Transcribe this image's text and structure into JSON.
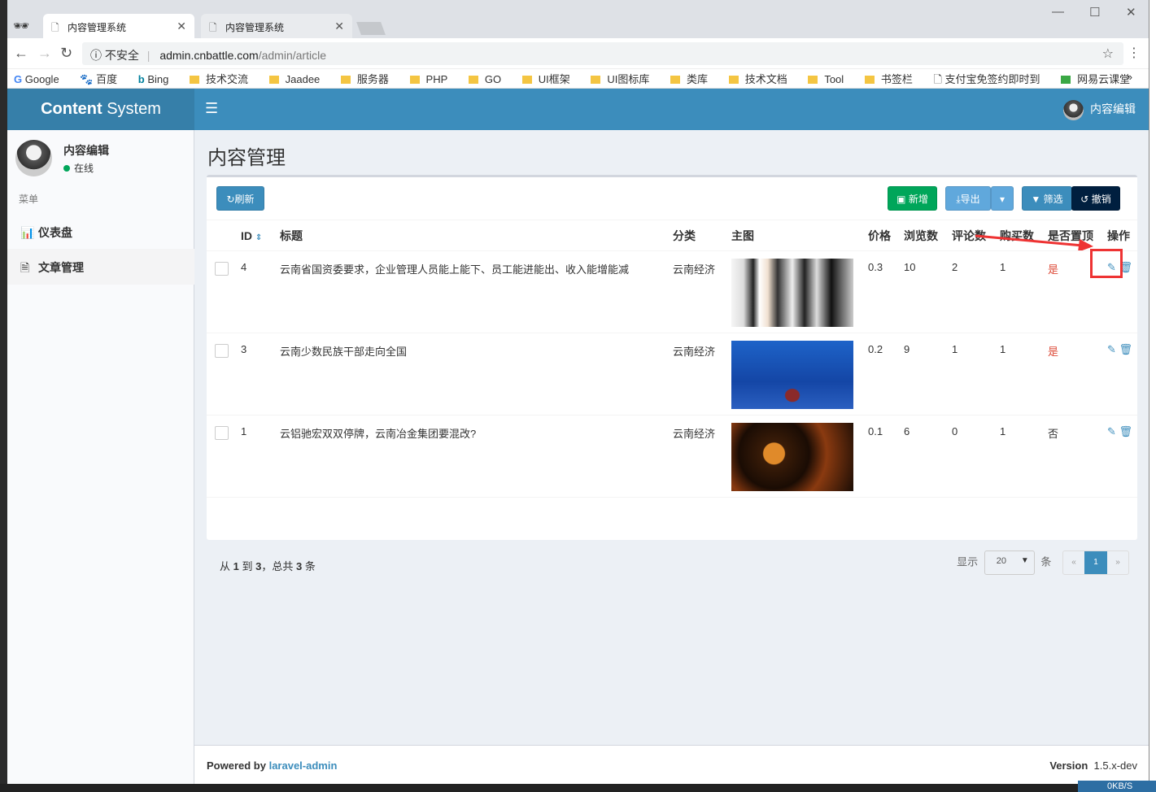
{
  "browser": {
    "tabs": [
      {
        "title": "内容管理系统",
        "active": true
      },
      {
        "title": "内容管理系统",
        "active": false
      }
    ],
    "security_label": "不安全",
    "url_host": "admin.cnbattle.com",
    "url_path": "/admin/article",
    "bookmarks": [
      "Google",
      "百度",
      "Bing",
      "技术交流",
      "Jaadee",
      "服务器",
      "PHP",
      "GO",
      "UI框架",
      "UI图标库",
      "类库",
      "技术文档",
      "Tool",
      "书签栏",
      "支付宝免签约即时到",
      "网易云课堂"
    ],
    "bookmarks_more": "»"
  },
  "header": {
    "brand_bold": "Content",
    "brand_rest": " System",
    "user": "内容编辑"
  },
  "sidebar": {
    "user": "内容编辑",
    "status": "在线",
    "menu_header": "菜单",
    "items": [
      {
        "label": "仪表盘",
        "icon": "bar-chart-icon"
      },
      {
        "label": "文章管理",
        "icon": "file-icon",
        "active": true
      }
    ]
  },
  "page": {
    "title": "内容管理"
  },
  "toolbar": {
    "refresh": "刷新",
    "new": "新增",
    "export": "导出",
    "filter": "筛选",
    "reset": "撤销"
  },
  "table": {
    "headers": {
      "id": "ID",
      "title": "标题",
      "category": "分类",
      "image": "主图",
      "price": "价格",
      "views": "浏览数",
      "comments": "评论数",
      "purchases": "购买数",
      "top": "是否置顶",
      "actions": "操作"
    },
    "rows": [
      {
        "id": "4",
        "title": "云南省国资委要求，企业管理人员能上能下、员工能进能出、收入能增能减",
        "category": "云南经济",
        "price": "0.3",
        "views": "10",
        "comments": "2",
        "purchases": "1",
        "top": "是"
      },
      {
        "id": "3",
        "title": "云南少数民族干部走向全国",
        "category": "云南经济",
        "price": "0.2",
        "views": "9",
        "comments": "1",
        "purchases": "1",
        "top": "是"
      },
      {
        "id": "1",
        "title": "云铝驰宏双双停牌，云南冶金集团要混改?",
        "category": "云南经济",
        "price": "0.1",
        "views": "6",
        "comments": "0",
        "purchases": "1",
        "top": "否"
      }
    ]
  },
  "footer_info": {
    "from_label": "从",
    "from": "1",
    "to_label": "到",
    "to": "3",
    "total_label": "，总共",
    "total": "3",
    "unit": "条"
  },
  "pager": {
    "show_label": "显示",
    "per_page": "20",
    "unit": "条",
    "prev": "«",
    "current": "1",
    "next": "»"
  },
  "footer": {
    "powered": "Powered by",
    "link": "laravel-admin",
    "version_label": "Version",
    "version": "1.5.x-dev"
  },
  "system": {
    "net_speed": "0KB/S"
  }
}
